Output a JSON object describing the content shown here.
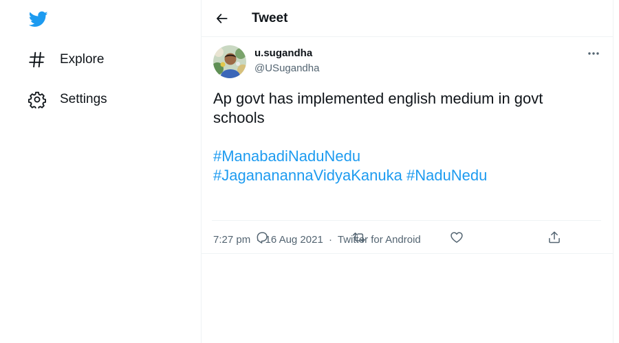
{
  "colors": {
    "accent": "#1d9bf0",
    "text": "#0f1419",
    "secondary": "#536471",
    "border": "#eff3f4"
  },
  "sidebar": {
    "logo_icon": "twitter-bird-icon",
    "items": [
      {
        "label": "Explore",
        "icon": "hashtag-icon"
      },
      {
        "label": "Settings",
        "icon": "gear-icon"
      }
    ]
  },
  "header": {
    "title": "Tweet",
    "back_icon": "arrow-left-icon"
  },
  "tweet": {
    "author_name": "u.sugandha",
    "author_handle": "@USugandha",
    "text": "Ap govt has implemented english medium in govt schools",
    "hashtags": [
      "#ManabadiNaduNedu",
      "#JagananannaVidyaKanuka",
      "#NaduNedu"
    ],
    "time": "7:27 pm",
    "date": "16 Aug 2021",
    "source": "Twitter for Android",
    "separator": "·"
  },
  "actions": [
    {
      "name": "reply",
      "icon": "reply-icon"
    },
    {
      "name": "retweet",
      "icon": "retweet-icon"
    },
    {
      "name": "like",
      "icon": "heart-icon"
    },
    {
      "name": "share",
      "icon": "share-icon"
    }
  ]
}
